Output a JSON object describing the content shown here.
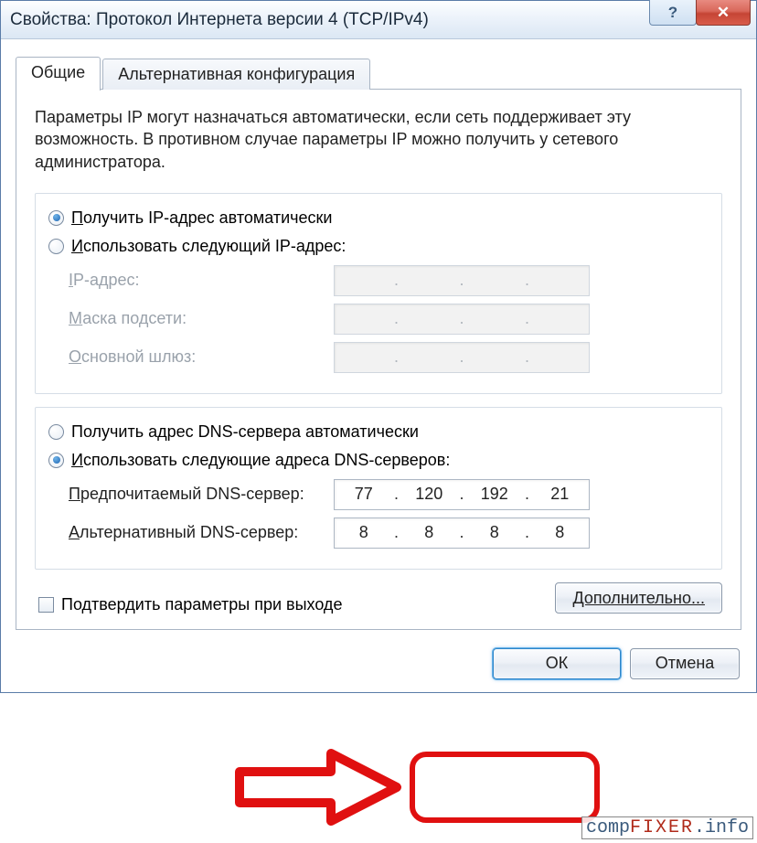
{
  "titlebar": {
    "title": "Свойства: Протокол Интернета версии 4 (TCP/IPv4)",
    "help_glyph": "?",
    "close_glyph": "✕"
  },
  "tabs": {
    "general": "Общие",
    "alt": "Альтернативная конфигурация"
  },
  "intro": "Параметры IP могут назначаться автоматически, если сеть поддерживает эту возможность. В противном случае параметры IP можно получить у сетевого администратора.",
  "ip_section": {
    "radio_auto_prefix": "П",
    "radio_auto_rest": "олучить IP-адрес автоматически",
    "radio_manual_prefix": "И",
    "radio_manual_rest": "спользовать следующий IP-адрес:",
    "ip_label_u": "I",
    "ip_label_rest": "P-адрес:",
    "mask_label_u": "М",
    "mask_label_rest": "аска подсети:",
    "gw_label_u": "О",
    "gw_label_rest": "сновной шлюз:"
  },
  "dns_section": {
    "radio_auto": "Получить адрес DNS-сервера автоматически",
    "radio_manual_prefix": "И",
    "radio_manual_rest": "спользовать следующие адреса DNS-серверов:",
    "pref_label_u": "П",
    "pref_label_rest": "редпочитаемый DNS-сервер:",
    "alt_label_u": "А",
    "alt_label_rest": "льтернативный DNS-сервер:",
    "pref_value": {
      "a": "77",
      "b": "120",
      "c": "192",
      "d": "21"
    },
    "alt_value": {
      "a": "8",
      "b": "8",
      "c": "8",
      "d": "8"
    }
  },
  "confirm_on_exit": "Подтвердить параметры при выходе",
  "advanced_btn": "Дополнительно...",
  "ok_btn": "ОК",
  "cancel_btn": "Отмена",
  "watermark": {
    "comp": "comp",
    "fixer": "FIXER",
    "info": ".info"
  }
}
